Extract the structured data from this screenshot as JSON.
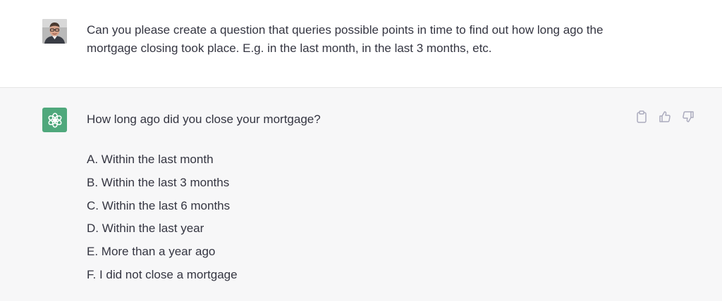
{
  "user_message": {
    "text": "Can you please create a question that queries possible points in time to find out how long ago the mortgage closing took place. E.g. in the last month, in the last 3 months, etc.",
    "avatar_icon": "user-photo-avatar"
  },
  "assistant_message": {
    "avatar_icon": "openai-logo-icon",
    "avatar_color": "#4fa87c",
    "question": "How long ago did you close your mortgage?",
    "options": [
      "A. Within the last month",
      "B. Within the last 3 months",
      "C. Within the last 6 months",
      "D. Within the last year",
      "E. More than a year ago",
      "F. I did not close a mortgage"
    ],
    "actions": [
      "clipboard-icon",
      "thumbs-up-icon",
      "thumbs-down-icon"
    ]
  },
  "colors": {
    "assistant_background": "#f7f7f8",
    "text": "#343541",
    "icon": "#acacbe"
  }
}
